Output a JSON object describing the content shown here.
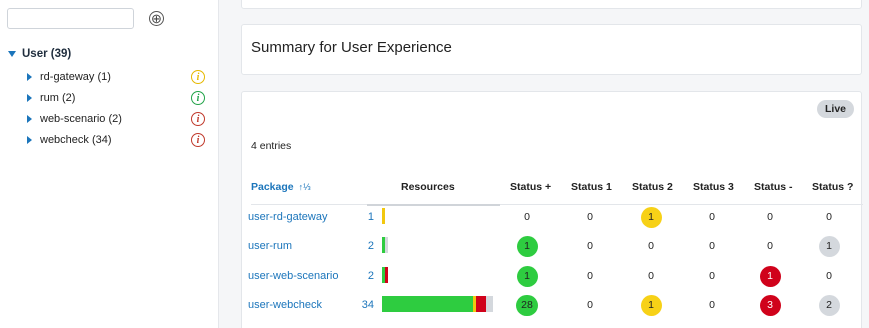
{
  "sidebar": {
    "search_value": "",
    "add_icon": "⊕",
    "root": {
      "label": "User (39)"
    },
    "items": [
      {
        "label": "rd-gateway (1)",
        "info_color": "#e6b800"
      },
      {
        "label": "rum (2)",
        "info_color": "#21a348"
      },
      {
        "label": "web-scenario (2)",
        "info_color": "#c0392b"
      },
      {
        "label": "webcheck (34)",
        "info_color": "#c0392b"
      }
    ]
  },
  "summary": {
    "title": "Summary for User Experience"
  },
  "table": {
    "live_label": "Live",
    "entries_text": "4 entries",
    "headers": {
      "package": "Package",
      "sort_icon": "↑⅓",
      "resources": "Resources",
      "status_plus": "Status +",
      "status_1": "Status 1",
      "status_2": "Status 2",
      "status_3": "Status 3",
      "status_minus": "Status -",
      "status_q": "Status ?"
    },
    "rows": [
      {
        "package": "user-rd-gateway",
        "resources": "1",
        "bar": [
          {
            "color": "#f2c80f",
            "fraction": 1
          }
        ],
        "status_plus": "0",
        "status_1": "0",
        "status_2": "1",
        "status_3": "0",
        "status_minus": "0",
        "status_q": "0"
      },
      {
        "package": "user-rum",
        "resources": "2",
        "bar": [
          {
            "color": "#2ecc40",
            "fraction": 0.5
          },
          {
            "color": "#d4d8dd",
            "fraction": 0.5
          }
        ],
        "status_plus": "1",
        "status_1": "0",
        "status_2": "0",
        "status_3": "0",
        "status_minus": "0",
        "status_q": "1"
      },
      {
        "package": "user-web-scenario",
        "resources": "2",
        "bar": [
          {
            "color": "#2ecc40",
            "fraction": 0.5
          },
          {
            "color": "#d0021b",
            "fraction": 0.5
          }
        ],
        "status_plus": "1",
        "status_1": "0",
        "status_2": "0",
        "status_3": "0",
        "status_minus": "1",
        "status_q": "0"
      },
      {
        "package": "user-webcheck",
        "resources": "34",
        "bar": [
          {
            "color": "#2ecc40",
            "fraction": 0.824
          },
          {
            "color": "#f2c80f",
            "fraction": 0.029
          },
          {
            "color": "#d0021b",
            "fraction": 0.088
          },
          {
            "color": "#d4d8dd",
            "fraction": 0.059
          }
        ],
        "status_plus": "28",
        "status_1": "0",
        "status_2": "1",
        "status_3": "0",
        "status_minus": "3",
        "status_q": "2"
      }
    ],
    "badge_colors": {
      "status_plus": "#2ecc40",
      "status_2": "#f7d117",
      "status_minus": "#d0021b",
      "status_q": "#d4d8dd"
    }
  }
}
